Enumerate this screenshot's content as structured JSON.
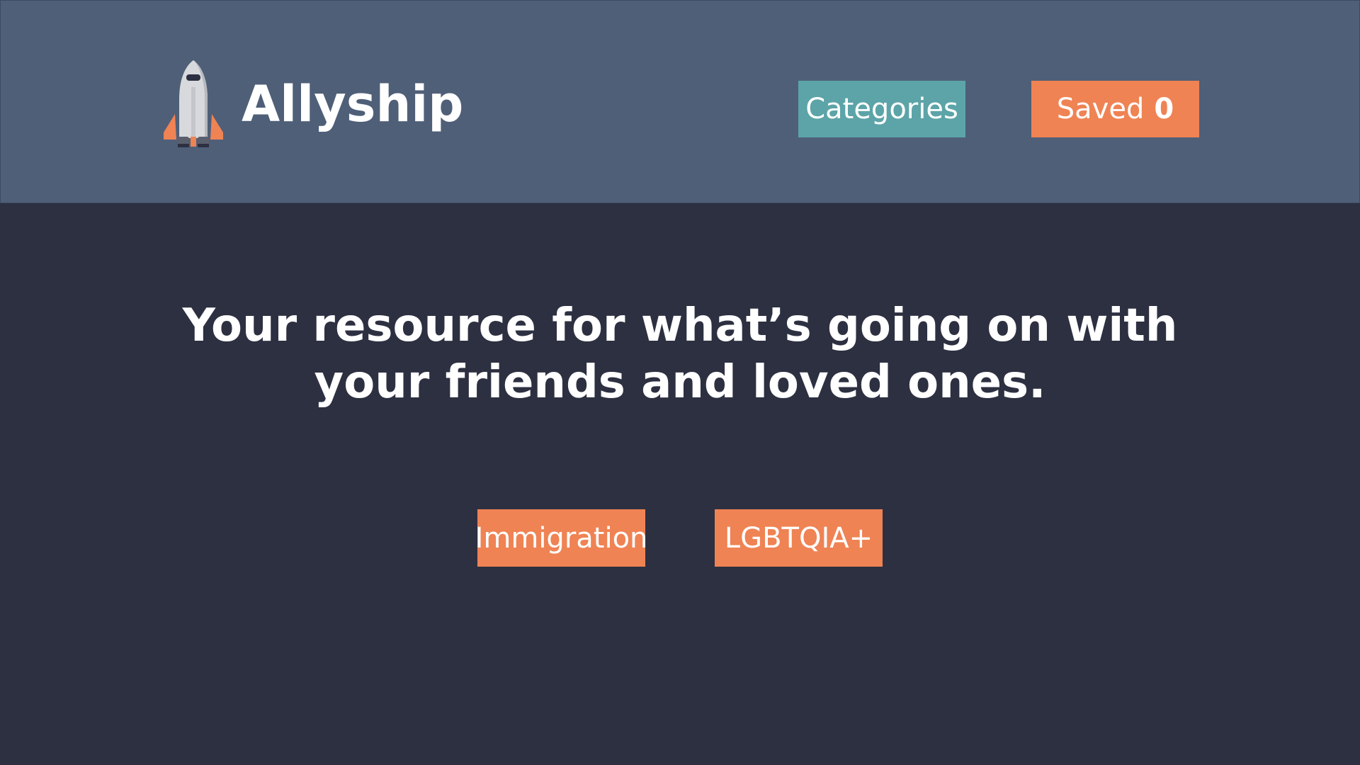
{
  "header": {
    "brand": {
      "name": "Allyship",
      "logo_icon": "rocket-icon"
    },
    "nav": {
      "categories_label": "Categories",
      "saved_label": "Saved",
      "saved_count": "0"
    }
  },
  "main": {
    "headline_line1": "Your resource for what’s going on with",
    "headline_line2": "your friends and loved ones.",
    "categories": [
      {
        "label": "Immigration"
      },
      {
        "label": "LGBTQIA+"
      }
    ]
  },
  "colors": {
    "header_bg": "#4f5f78",
    "page_bg": "#2d3041",
    "accent_orange": "#ef8354",
    "accent_teal": "#5ca4a8",
    "text": "#ffffff"
  }
}
